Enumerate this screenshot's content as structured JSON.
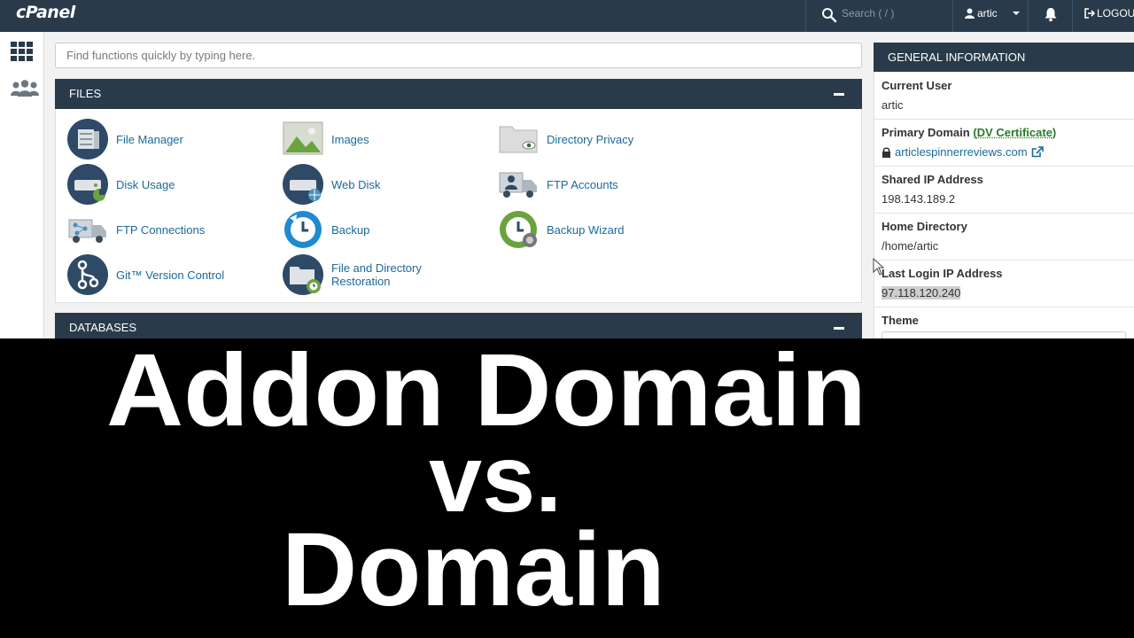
{
  "topbar": {
    "logo": "cPanel",
    "search_placeholder": "Search ( / )",
    "user": "artic",
    "logout": "LOGOU"
  },
  "quick_find": {
    "placeholder": "Find functions quickly by typing here."
  },
  "files": {
    "title": "FILES",
    "items": [
      {
        "label": "File Manager",
        "icon": "file-manager-icon"
      },
      {
        "label": "Images",
        "icon": "images-icon"
      },
      {
        "label": "Directory Privacy",
        "icon": "directory-privacy-icon"
      },
      {
        "label": "Disk Usage",
        "icon": "disk-usage-icon"
      },
      {
        "label": "Web Disk",
        "icon": "web-disk-icon"
      },
      {
        "label": "FTP Accounts",
        "icon": "ftp-accounts-icon"
      },
      {
        "label": "FTP Connections",
        "icon": "ftp-connections-icon"
      },
      {
        "label": "Backup",
        "icon": "backup-icon"
      },
      {
        "label": "Backup Wizard",
        "icon": "backup-wizard-icon"
      },
      {
        "label": "Git™ Version Control",
        "icon": "git-icon"
      },
      {
        "label": "File and Directory Restoration",
        "icon": "restoration-icon"
      }
    ]
  },
  "databases": {
    "title": "DATABASES"
  },
  "general_info": {
    "title": "GENERAL INFORMATION",
    "current_user_label": "Current User",
    "current_user": "artic",
    "primary_domain_label": "Primary Domain",
    "certificate_open": "(",
    "certificate": "DV Certificate",
    "certificate_close": ")",
    "primary_domain": "articlespinnerreviews.com",
    "shared_ip_label": "Shared IP Address",
    "shared_ip": "198.143.189.2",
    "home_dir_label": "Home Directory",
    "home_dir": "/home/artic",
    "last_login_label": "Last Login IP Address",
    "last_login": "97.118.120.240",
    "theme_label": "Theme"
  },
  "overlay": {
    "line1": "Addon Domain",
    "line2": "vs.",
    "line3": "Domain"
  },
  "colors": {
    "nav": "#293a4a",
    "link": "#1a6a9a",
    "overlay_bg": "#000000"
  }
}
